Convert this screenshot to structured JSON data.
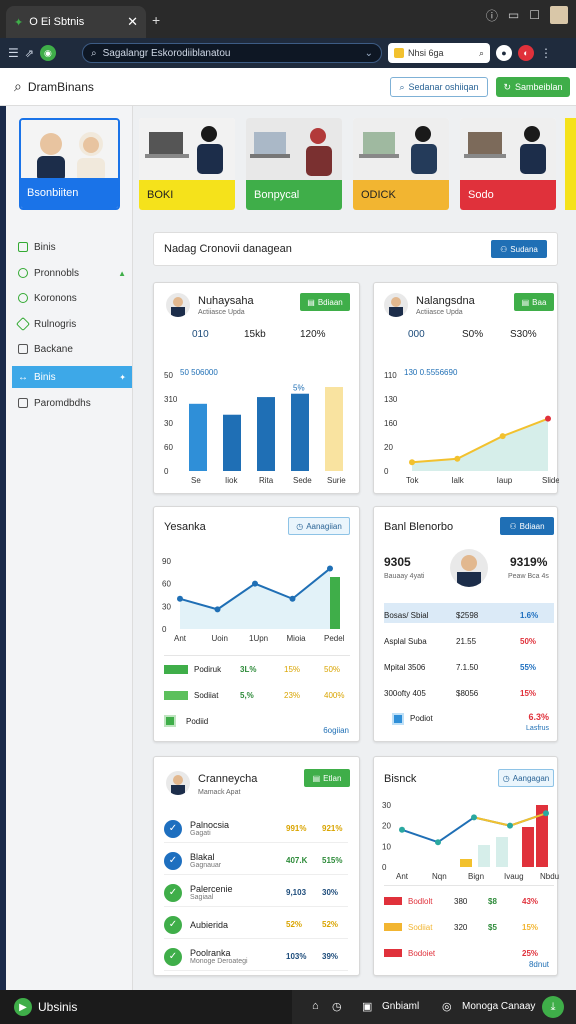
{
  "browser": {
    "tab_title": "O Ei Sbtnis",
    "address": "Sagalangr Eskorodiiblanatou",
    "search_text": "Nhsi 6ga"
  },
  "appbar": {
    "title": "DramBinans",
    "outline_button": "Sedanar oshiiqan",
    "green_button": "Sambeiblan"
  },
  "sidebar": {
    "profile_label": "Bsonbiiten",
    "items": [
      {
        "label": "Binis"
      },
      {
        "label": "Pronnobls"
      },
      {
        "label": "Koronons"
      },
      {
        "label": "Rulnogris"
      },
      {
        "label": "Backane"
      },
      {
        "label": "Binis"
      },
      {
        "label": "Paromdbdhs"
      }
    ]
  },
  "tiles": [
    {
      "label": "BOKI",
      "color": "#f5e21b"
    },
    {
      "label": "Bonpycal",
      "color": "#3fae49"
    },
    {
      "label": "ODICK",
      "color": "#f2b531"
    },
    {
      "label": "Sodo",
      "color": "#e0313b"
    }
  ],
  "header": {
    "title": "Nadag Cronovii danagean",
    "button": "Sudana"
  },
  "panel1": {
    "title": "Nuhaysaha",
    "subtitle": "Actiiasce Upda",
    "button": "Bdiaan",
    "stats": [
      "010",
      "15kb",
      "120%"
    ]
  },
  "panel2": {
    "title": "Nalangsdna",
    "subtitle": "Actiiasce Upda",
    "button": "Baa",
    "stats": [
      "000",
      "S0%",
      "S30%"
    ]
  },
  "panel3": {
    "title": "Yesanka",
    "button": "Aanagiian",
    "legend": [
      {
        "label": "Podiruk",
        "v1": "3L%",
        "v2": "15%",
        "v3": "50%"
      },
      {
        "label": "Sodiiat",
        "v1": "5,%",
        "v2": "23%",
        "v3": "400%"
      },
      {
        "label": "Podiid"
      }
    ],
    "footer": "6ogiian"
  },
  "panel4": {
    "title": "Banl Blenorbo",
    "button": "Bdiaan",
    "left_value": "9305",
    "left_sub": "Bauaay 4yati",
    "right_value": "9319%",
    "right_sub": "Peaw Bca 4s",
    "rows": [
      {
        "label": "Bosas/ Sbial",
        "v1": "$2598",
        "v2": "1.6%",
        "color": "#1e6fbf"
      },
      {
        "label": "Asplal Suba",
        "v1": "21.55",
        "v2": "50%",
        "color": "#e0313b"
      },
      {
        "label": "Mpital 3506",
        "v1": "7.1.50",
        "v2": "55%",
        "color": "#1e6fbf"
      },
      {
        "label": "300ofty 405",
        "v1": "$8056",
        "v2": "15%",
        "color": "#e0313b"
      }
    ],
    "footer_label": "Podiot",
    "footer_value": "6.3%",
    "footer_sub": "Lasfrus"
  },
  "panel5": {
    "title": "Cranneycha",
    "subtitle": "Mamack Apat",
    "button": "Etlan",
    "rows": [
      {
        "title": "Palnocsia",
        "sub": "Gagati",
        "v1": "991%",
        "v2": "921%",
        "icon_color": "#1e6fbf",
        "val_color": "#d9a400"
      },
      {
        "title": "Blakal",
        "sub": "Gagnauar",
        "v1": "407.K",
        "v2": "515%",
        "icon_color": "#1e6fbf",
        "val_color": "#2e8b3a"
      },
      {
        "title": "Palercenie",
        "sub": "Sagiaal",
        "v1": "9,103",
        "v2": "30%",
        "icon_color": "#3fae49",
        "val_color": "#1c4b7a"
      },
      {
        "title": "Aubierida",
        "sub": "",
        "v1": "52%",
        "v2": "52%",
        "icon_color": "#3fae49",
        "val_color": "#d9a400"
      },
      {
        "title": "Poolranka",
        "sub": "Monoge Deroategi",
        "v1": "103%",
        "v2": "39%",
        "icon_color": "#3fae49",
        "val_color": "#1c4b7a"
      }
    ]
  },
  "panel6": {
    "title": "Bisnck",
    "button": "Aangagan",
    "rows": [
      {
        "label": "Bodlolt",
        "v1": "$8",
        "v2": "43%",
        "color": "#e0313b"
      },
      {
        "label": "Sodiiat",
        "v1": "$5",
        "v2": "15%",
        "color": "#f2b531"
      },
      {
        "label": "Bodoiet",
        "v1": "",
        "v2": "25%",
        "color": "#e0313b"
      }
    ],
    "row_mid": "380",
    "row_mid2": "320",
    "footer": "8dnut"
  },
  "taskbar": {
    "app": "Ubsinis",
    "item1": "Gnbiaml",
    "item2": "Monoga Canaay"
  },
  "chart_data": [
    {
      "type": "bar",
      "title": "",
      "categories": [
        "Se",
        "Iiok",
        "Rita",
        "Sede",
        "Surie"
      ],
      "values": [
        80,
        67,
        88,
        92,
        100
      ],
      "ylim": [
        0,
        100
      ],
      "tick_labels": [
        "50",
        "310",
        "30",
        "60",
        "0"
      ],
      "annotation": "50 506000",
      "data_labels": [
        "",
        "",
        "",
        "5%",
        ""
      ],
      "colors": [
        "#2f8fd8",
        "#1f6fb5",
        "#1f6fb5",
        "#1f6fb5",
        "#f9e3a0"
      ]
    },
    {
      "type": "area",
      "title": "",
      "categories": [
        "Tok",
        "Ialk",
        "Iaup",
        "Slide"
      ],
      "values": [
        10,
        14,
        40,
        60
      ],
      "ylim": [
        0,
        110
      ],
      "tick_labels": [
        "110",
        "130",
        "160",
        "20",
        "0"
      ],
      "annotation": "130 0.5556690"
    },
    {
      "type": "line",
      "title": "",
      "categories": [
        "Ant",
        "Uoin",
        "1Upn",
        "Mioia",
        "Pedel"
      ],
      "values": [
        40,
        26,
        60,
        40,
        80
      ],
      "ylim": [
        0,
        90
      ],
      "tick_labels": [
        "90",
        "60",
        "30",
        "0"
      ]
    },
    {
      "type": "line",
      "title": "",
      "categories": [
        "Ant",
        "Nqn",
        "Bign",
        "Ivaug",
        "Nbdu"
      ],
      "values": [
        18,
        12,
        24,
        20,
        26
      ],
      "ylim": [
        0,
        30
      ],
      "tick_labels": [
        "30",
        "20",
        "10",
        "0"
      ]
    }
  ]
}
